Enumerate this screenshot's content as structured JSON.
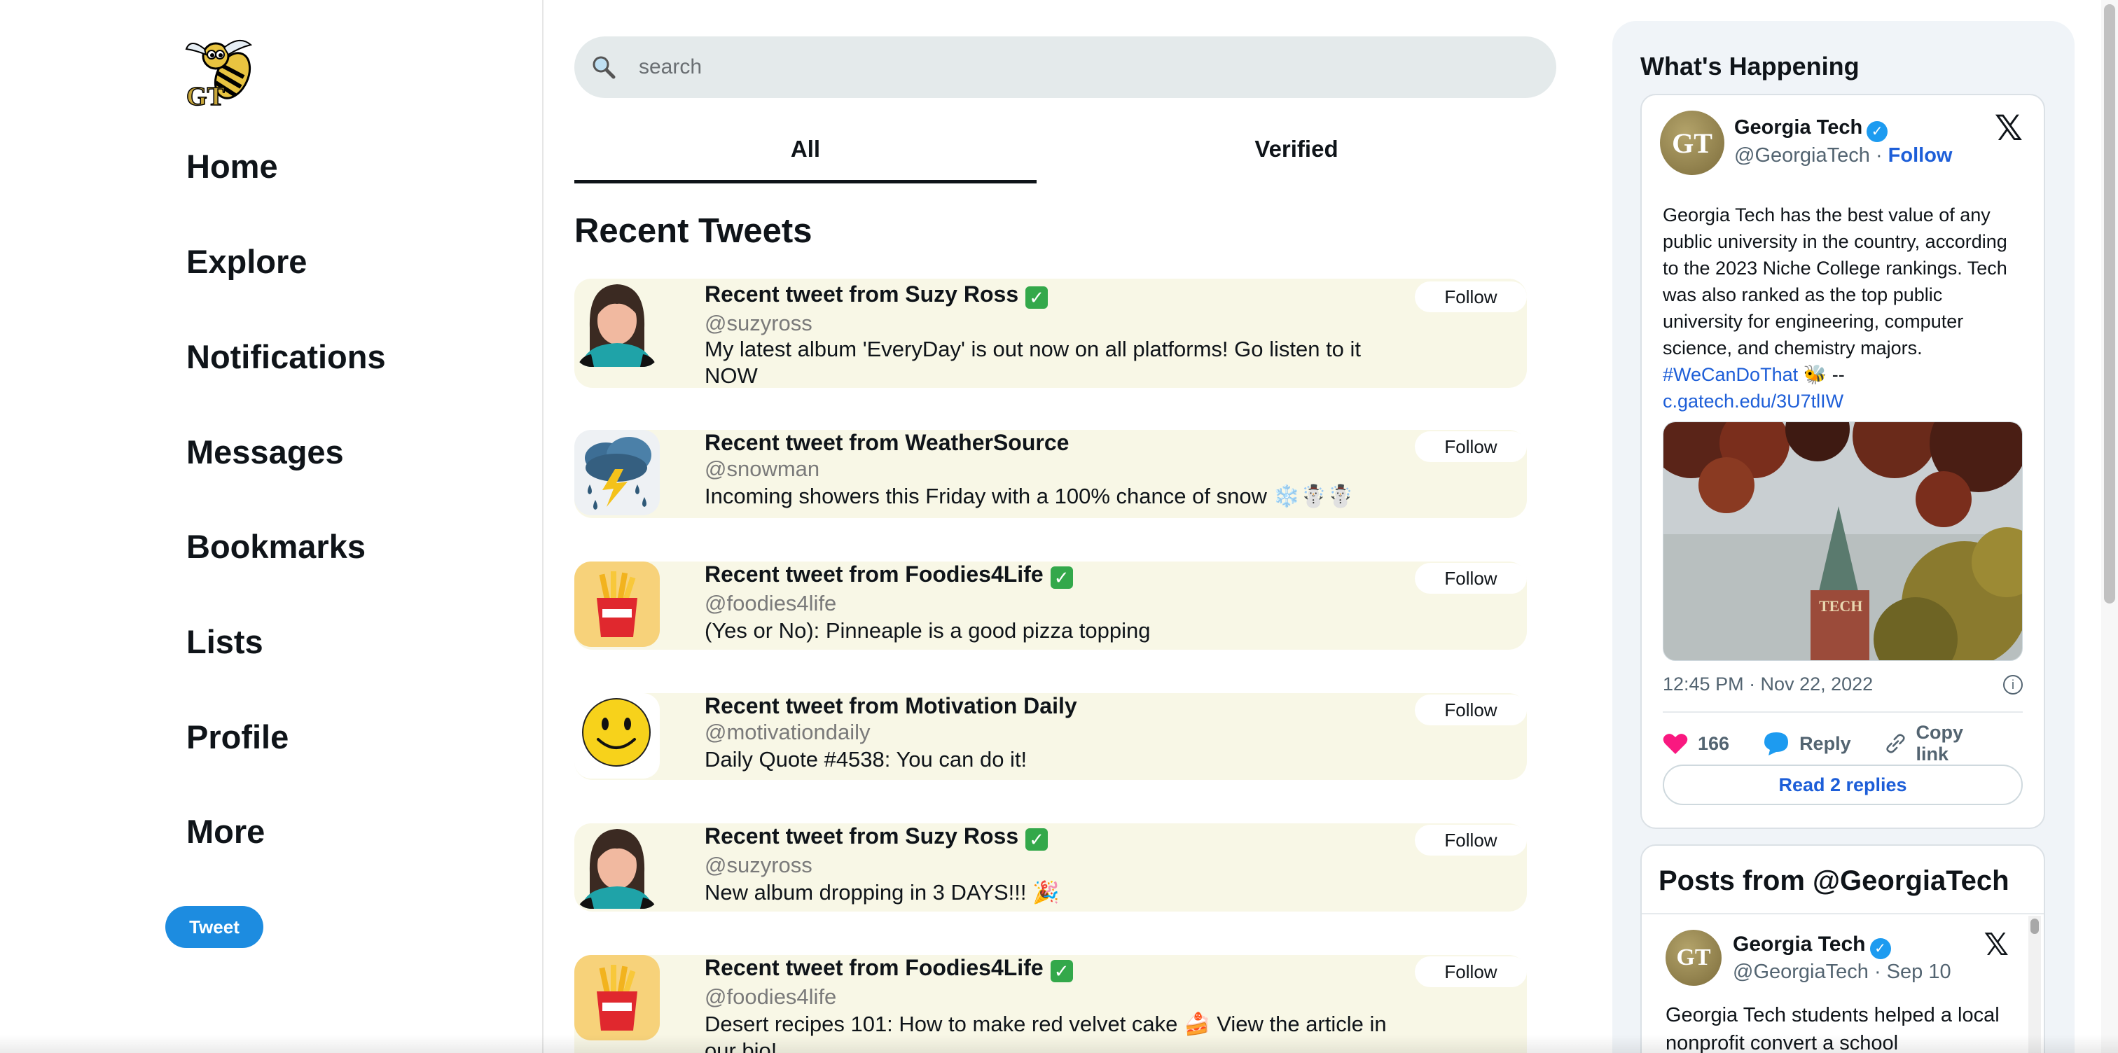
{
  "nav": {
    "logo_icon": "yellow-jacket-gt-logo",
    "items": [
      {
        "label": "Home"
      },
      {
        "label": "Explore"
      },
      {
        "label": "Notifications"
      },
      {
        "label": "Messages"
      },
      {
        "label": "Bookmarks"
      },
      {
        "label": "Lists"
      },
      {
        "label": "Profile"
      },
      {
        "label": "More"
      }
    ],
    "tweet_button": "Tweet"
  },
  "search": {
    "placeholder": "search",
    "icon": "search-icon"
  },
  "tabs": [
    {
      "label": "All",
      "active": true
    },
    {
      "label": "Verified",
      "active": false
    }
  ],
  "feed": {
    "title": "Recent Tweets",
    "follow_label": "Follow",
    "tweets": [
      {
        "title": "Recent tweet from Suzy Ross",
        "verified": true,
        "handle": "@suzyross",
        "text": "My latest album 'EveryDay' is out now on all platforms! Go listen to it NOW",
        "avatar": "woman-avatar-icon"
      },
      {
        "title": "Recent tweet from WeatherSource",
        "verified": false,
        "handle": "@snowman",
        "text": "Incoming showers this Friday with a 100% chance of snow ❄️☃️☃️",
        "avatar": "storm-cloud-icon"
      },
      {
        "title": "Recent tweet from Foodies4Life",
        "verified": true,
        "handle": "@foodies4life",
        "text": "(Yes or No): Pinneaple is a good pizza topping",
        "avatar": "french-fries-icon"
      },
      {
        "title": "Recent tweet from Motivation Daily",
        "verified": false,
        "handle": "@motivationdaily",
        "text": "Daily Quote #4538: You can do it!",
        "avatar": "smiley-face-icon"
      },
      {
        "title": "Recent tweet from Suzy Ross",
        "verified": true,
        "handle": "@suzyross",
        "text": "New album dropping in 3 DAYS!!! 🎉",
        "avatar": "woman-avatar-icon"
      },
      {
        "title": "Recent tweet from Foodies4Life",
        "verified": true,
        "handle": "@foodies4life",
        "text": "Desert recipes 101: How to make red velvet cake 🍰 View the article in our bio!",
        "avatar": "french-fries-icon"
      }
    ]
  },
  "happening": {
    "title": "What's Happening",
    "embed": {
      "name": "Georgia Tech",
      "handle": "@GeorgiaTech",
      "separator": "·",
      "follow": "Follow",
      "avatar_text": "GT",
      "body_text": "Georgia Tech has the best value of any public university in the country, according to the 2023 Niche College rankings. Tech was also ranked as the top public university for engineering, computer science, and chemistry majors.",
      "hashtag": "#WeCanDoThat",
      "emoji": "🐝",
      "dashes": "--",
      "url": "c.gatech.edu/3U7tlIW",
      "time": "12:45 PM · Nov 22, 2022",
      "likes": "166",
      "reply": "Reply",
      "copy_link": "Copy link",
      "read_replies": "Read 2 replies"
    },
    "posts": {
      "title": "Posts from @GeorgiaTech",
      "name": "Georgia Tech",
      "handle": "@GeorgiaTech",
      "separator": "·",
      "date": "Sep 10",
      "text": "Georgia Tech students helped a local nonprofit convert a school"
    }
  },
  "colors": {
    "accent_blue": "#1d8ce0",
    "link_blue": "#1d5ed8",
    "tweet_card_bg": "#f8f7e6",
    "verified_green": "#33a84a",
    "like_pink": "#f91880"
  }
}
